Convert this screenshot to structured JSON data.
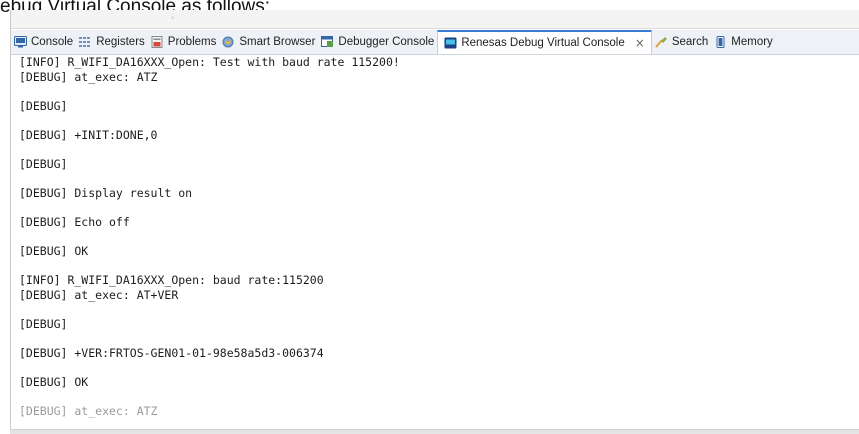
{
  "caption": "ebug Virtual Console as follows:",
  "tabs": [
    {
      "label": "Console",
      "icon": "console-icon",
      "active": false
    },
    {
      "label": "Registers",
      "icon": "registers-icon",
      "active": false
    },
    {
      "label": "Problems",
      "icon": "problems-icon",
      "active": false
    },
    {
      "label": "Smart Browser",
      "icon": "smart-browser-icon",
      "active": false
    },
    {
      "label": "Debugger Console",
      "icon": "debugger-console-icon",
      "active": false
    },
    {
      "label": "Renesas Debug Virtual Console",
      "icon": "renesas-console-icon",
      "active": true,
      "close": "×"
    },
    {
      "label": "Search",
      "icon": "search-icon",
      "active": false
    },
    {
      "label": "Memory",
      "icon": "memory-icon",
      "active": false
    }
  ],
  "console": {
    "lines": [
      "[INFO] R_WIFI_DA16XXX_Open: Test with baud rate 115200!",
      "[DEBUG] at_exec: ATZ",
      "[DEBUG]",
      "[DEBUG] +INIT:DONE,0",
      "[DEBUG]",
      "[DEBUG] Display result on",
      "[DEBUG] Echo off",
      "[DEBUG] OK",
      "[INFO] R_WIFI_DA16XXX_Open: baud rate:115200",
      "[DEBUG] at_exec: AT+VER",
      "[DEBUG]",
      "[DEBUG] +VER:FRTOS-GEN01-01-98e58a5d3-006374",
      "[DEBUG] OK",
      "[DEBUG] at_exec: ATZ"
    ]
  },
  "colors": {
    "active_tab_accent": "#3a7bd5",
    "text": "#1d1d1d"
  }
}
